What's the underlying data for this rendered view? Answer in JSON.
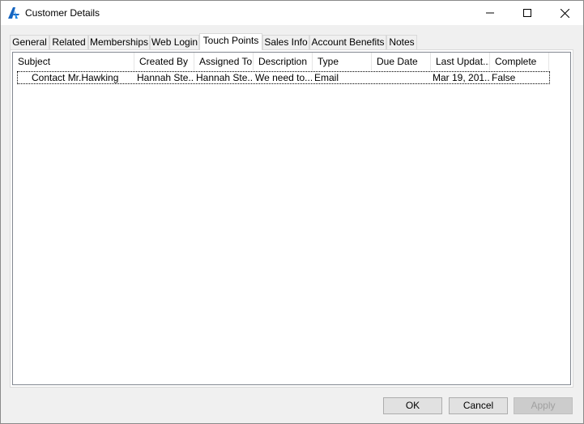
{
  "window": {
    "title": "Customer Details"
  },
  "tabs": [
    {
      "label": "General"
    },
    {
      "label": "Related"
    },
    {
      "label": "Memberships"
    },
    {
      "label": "Web Login"
    },
    {
      "label": "Touch Points",
      "active": true
    },
    {
      "label": "Sales Info"
    },
    {
      "label": "Account Benefits"
    },
    {
      "label": "Notes"
    }
  ],
  "grid": {
    "columns": [
      "Subject",
      "Created By",
      "Assigned To",
      "Description",
      "Type",
      "Due Date",
      "Last Updat...",
      "Complete"
    ],
    "rows": [
      {
        "subject": "Contact Mr.Hawking",
        "created_by": "Hannah  Ste...",
        "assigned_to": "Hannah  Ste...",
        "description": "We need to...",
        "type": "Email",
        "due_date": "",
        "last_updated": "Mar 19, 201...",
        "complete": "False"
      }
    ]
  },
  "buttons": {
    "ok": "OK",
    "cancel": "Cancel",
    "apply": "Apply"
  },
  "colors": {
    "accent_icon": "#1565c0",
    "focus_row_border": "#000000",
    "disabled_text": "#a0a0a0"
  }
}
